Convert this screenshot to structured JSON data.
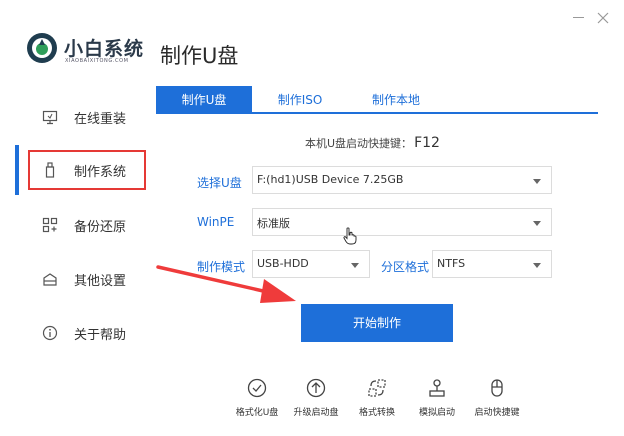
{
  "app": {
    "name": "小白系统",
    "subtitle": "XIAOBAIXITONG.COM"
  },
  "page_title": "制作U盘",
  "sidebar": {
    "items": [
      {
        "label": "在线重装",
        "icon": "monitor-icon"
      },
      {
        "label": "制作系统",
        "icon": "usb-icon",
        "active": true
      },
      {
        "label": "备份还原",
        "icon": "grid-icon"
      },
      {
        "label": "其他设置",
        "icon": "box-icon"
      },
      {
        "label": "关于帮助",
        "icon": "info-icon"
      }
    ]
  },
  "tabs": [
    {
      "label": "制作U盘",
      "active": true
    },
    {
      "label": "制作ISO"
    },
    {
      "label": "制作本地"
    }
  ],
  "hotkey": {
    "text": "本机U盘启动快捷键：",
    "key": "F12"
  },
  "form": {
    "usb_label": "选择U盘",
    "usb_value": "F:(hd1)USB Device 7.25GB",
    "winpe_label": "WinPE",
    "winpe_value": "标准版",
    "mode_label": "制作模式",
    "mode_value": "USB-HDD",
    "partition_label": "分区格式",
    "partition_value": "NTFS"
  },
  "start_button": "开始制作",
  "tools": [
    {
      "label": "格式化U盘",
      "icon": "check-circle-icon"
    },
    {
      "label": "升级启动盘",
      "icon": "up-arrow-circle-icon"
    },
    {
      "label": "格式转换",
      "icon": "convert-icon"
    },
    {
      "label": "模拟启动",
      "icon": "joystick-icon"
    },
    {
      "label": "启动快捷键",
      "icon": "mouse-icon"
    }
  ],
  "colors": {
    "accent": "#1e6fd9",
    "highlight": "#e53935"
  }
}
